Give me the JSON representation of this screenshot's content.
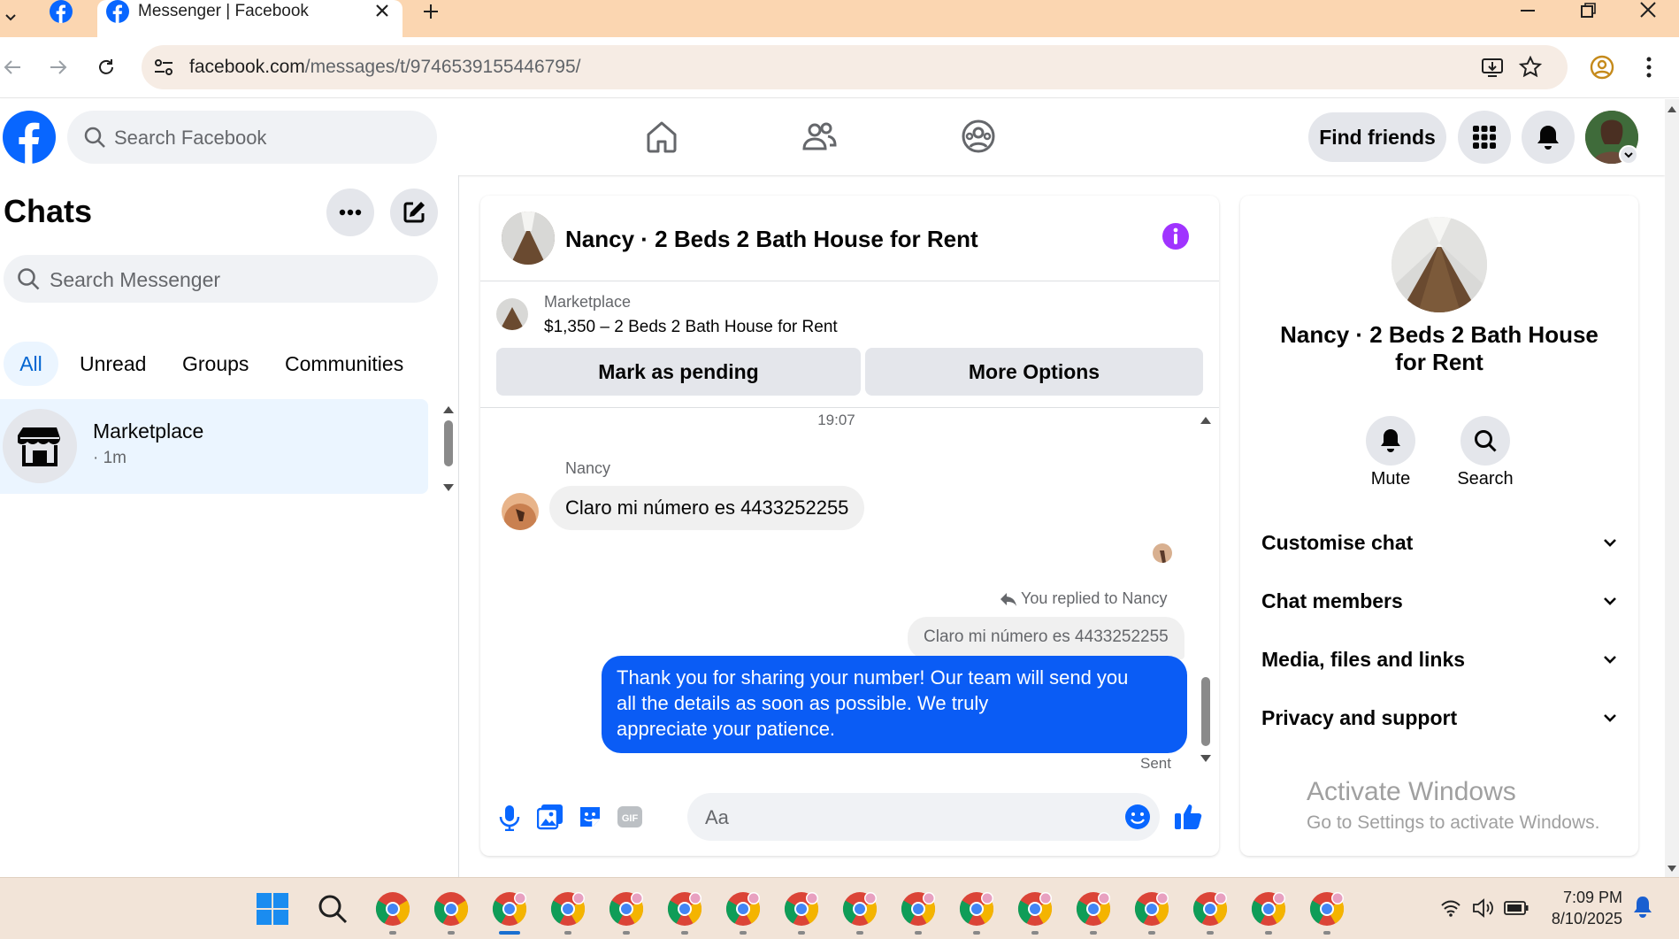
{
  "browser": {
    "tab_title": "Messenger | Facebook",
    "url_domain": "facebook.com",
    "url_path": "/messages/t/9746539155446795/"
  },
  "header": {
    "search_placeholder": "Search Facebook",
    "find_friends": "Find friends"
  },
  "sidebar": {
    "title": "Chats",
    "search_placeholder": "Search Messenger",
    "filters": [
      "All",
      "Unread",
      "Groups",
      "Communities"
    ],
    "chat": {
      "name": "Marketplace",
      "time": "· 1m"
    }
  },
  "conversation": {
    "title": "Nancy · 2 Beds 2 Bath House for Rent",
    "marketplace_label": "Marketplace",
    "listing": "$1,350 – 2 Beds 2 Bath House for Rent",
    "mark_pending": "Mark as pending",
    "more_options": "More Options",
    "timestamp": "19:07",
    "sender_name": "Nancy",
    "incoming_message": "Claro mi número es 4433252255",
    "reply_label": "You replied to Nancy",
    "quoted_message": "Claro mi número es 4433252255",
    "outgoing_lines": [
      "Thank you for sharing your number!  Our team will send you",
      "all the details as soon as possible. We truly",
      "appreciate your patience."
    ],
    "status": "Sent",
    "composer_placeholder": "Aa"
  },
  "details": {
    "name_line1": "Nancy · 2 Beds 2 Bath House",
    "name_line2": "for Rent",
    "mute": "Mute",
    "search": "Search",
    "sections": [
      "Customise chat",
      "Chat members",
      "Media, files and links",
      "Privacy and support"
    ]
  },
  "watermark": {
    "line1": "Activate Windows",
    "line2": "Go to Settings to activate Windows."
  },
  "taskbar": {
    "time": "7:09 PM",
    "date": "8/10/2025"
  },
  "colors": {
    "fb_blue": "#0866ff",
    "sent_bubble": "#0a5cf5",
    "info_purple": "#a033ff",
    "tab_bar": "#fbd6b1"
  }
}
